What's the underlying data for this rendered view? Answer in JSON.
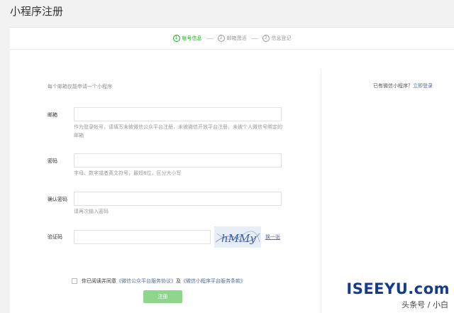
{
  "header": {
    "title": "小程序注册"
  },
  "steps": [
    {
      "num": "1",
      "label": "帐号信息"
    },
    {
      "num": "2",
      "label": "邮箱激活"
    },
    {
      "num": "3",
      "label": "信息登记"
    }
  ],
  "form": {
    "intro": "每个邮箱仅能申请一个小程序",
    "login_prompt": "已有微信小程序？",
    "login_link": "立即登录",
    "email_label": "邮箱",
    "email_help": "作为登录帐号，请填写未被微信公众平台注册，未被微信开放平台注册，未被个人微信号绑定的邮箱",
    "password_label": "密码",
    "password_help": "字母、数字或者英文符号，最短8位，区分大小写",
    "confirm_label": "确认密码",
    "confirm_help": "请再次输入密码",
    "captcha_label": "验证码",
    "captcha_text": "hMMy",
    "swap_label": "换一张",
    "agree_prefix": "你已阅读并同意",
    "agree_link1": "《微信公众平台服务协议》",
    "agree_mid": "及",
    "agree_link2": "《微信小程序平台服务条款》",
    "submit_label": "注册"
  },
  "watermark": {
    "brand": "ISEEYU.com",
    "sub": "头条号 / 小白"
  },
  "colors": {
    "accent": "#1aad19",
    "link": "#576b95"
  }
}
